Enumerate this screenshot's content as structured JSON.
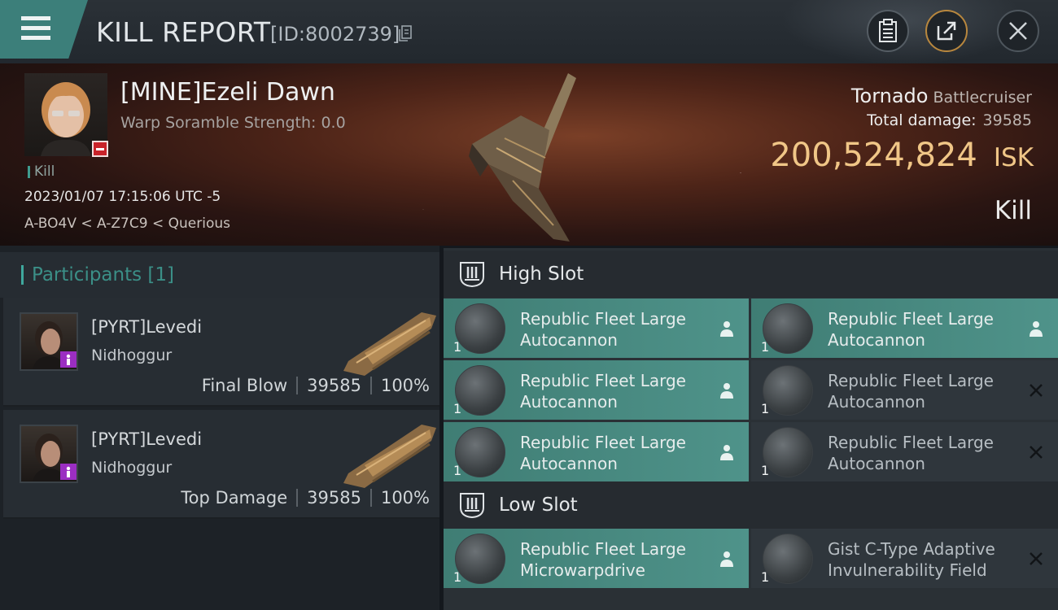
{
  "header": {
    "title": "KILL REPORT",
    "report_id": "[ID:8002739]",
    "icons": [
      "menu-icon",
      "copy-icon",
      "clipboard-icon",
      "share-icon",
      "close-icon"
    ]
  },
  "victim": {
    "name": "[MINE]Ezeli Dawn",
    "warp_scramble": "Warp Soramble Strength: 0.0",
    "tag": "Kill",
    "datetime": "2023/01/07 17:15:06 UTC -5",
    "location": "A-BO4V < A-Z7C9 < Querious",
    "ship_name": "Tornado",
    "ship_class": "Battlecruiser",
    "total_damage_label": "Total damage:",
    "total_damage": "39585",
    "isk_value": "200,524,824",
    "isk_unit": "ISK",
    "result": "Kill"
  },
  "participants": {
    "header": "Participants [1]",
    "items": [
      {
        "name": "[PYRT]Levedi",
        "ship": "Nidhoggur",
        "role": "Final Blow",
        "damage": "39585",
        "percent": "100%"
      },
      {
        "name": "[PYRT]Levedi",
        "ship": "Nidhoggur",
        "role": "Top Damage",
        "damage": "39585",
        "percent": "100%"
      }
    ]
  },
  "fittings": {
    "high_slot_label": "High Slot",
    "low_slot_label": "Low Slot",
    "high": [
      {
        "name": "Republic Fleet Large Autocannon",
        "qty": "1",
        "status": "dropped"
      },
      {
        "name": "Republic Fleet Large Autocannon",
        "qty": "1",
        "status": "dropped"
      },
      {
        "name": "Republic Fleet Large Autocannon",
        "qty": "1",
        "status": "dropped"
      },
      {
        "name": "Republic Fleet Large Autocannon",
        "qty": "1",
        "status": "destroyed"
      },
      {
        "name": "Republic Fleet Large Autocannon",
        "qty": "1",
        "status": "dropped"
      },
      {
        "name": "Republic Fleet Large Autocannon",
        "qty": "1",
        "status": "destroyed"
      }
    ],
    "low": [
      {
        "name": "Republic Fleet Large Microwarpdrive",
        "qty": "1",
        "status": "dropped"
      },
      {
        "name": "Gist C-Type Adaptive Invulnerability Field",
        "qty": "1",
        "status": "destroyed"
      }
    ]
  },
  "colors": {
    "accent_teal": "#3fa89d",
    "isk_gold": "#f0c687",
    "dropped_bg": "#4f938a",
    "destroyed_bg": "#2f363c"
  }
}
